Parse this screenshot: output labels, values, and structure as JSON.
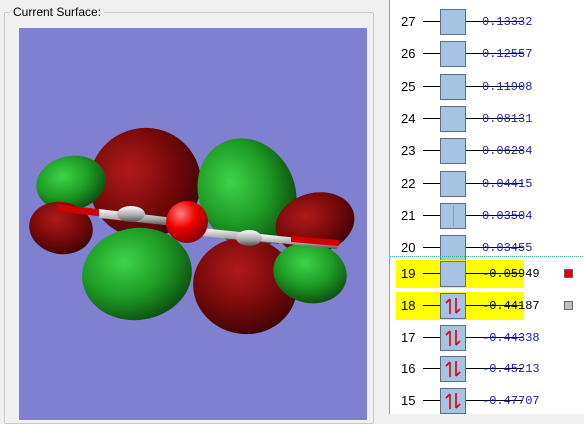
{
  "surface_group": {
    "title": "Current Surface:"
  },
  "viewport": {
    "background": "#8080d0",
    "lobe_colors": {
      "positive": "#1f8a22",
      "negative": "#7a0a0a"
    },
    "atom_colors": {
      "oxygen": "#e00000",
      "carbon": "#b0b0b0"
    }
  },
  "orbitals": [
    {
      "number": "27",
      "energy": "0.13332",
      "electrons": "none",
      "highlighted": false
    },
    {
      "number": "26",
      "energy": "0.12557",
      "electrons": "none",
      "highlighted": false
    },
    {
      "number": "25",
      "energy": "0.11908",
      "electrons": "none",
      "highlighted": false
    },
    {
      "number": "24",
      "energy": "0.08131",
      "electrons": "none",
      "highlighted": false
    },
    {
      "number": "23",
      "energy": "0.06284",
      "electrons": "none",
      "highlighted": false
    },
    {
      "number": "22",
      "energy": "0.04415",
      "electrons": "none",
      "highlighted": false
    },
    {
      "number": "21",
      "energy": "0.03504",
      "electrons": "none",
      "highlighted": false,
      "degenerate": true
    },
    {
      "number": "20",
      "energy": "0.03455",
      "electrons": "none",
      "highlighted": false
    },
    {
      "number": "19",
      "energy": "-0.05949",
      "electrons": "none",
      "highlighted": true,
      "marker": "#e00000"
    },
    {
      "number": "18",
      "energy": "-0.44187",
      "electrons": "pair",
      "highlighted": true,
      "marker": "#c0c0c0"
    },
    {
      "number": "17",
      "energy": "-0.44338",
      "electrons": "pair",
      "highlighted": false
    },
    {
      "number": "16",
      "energy": "-0.45213",
      "electrons": "pair",
      "highlighted": false
    },
    {
      "number": "15",
      "energy": "-0.47707",
      "electrons": "pair",
      "highlighted": false
    }
  ],
  "colors": {
    "highlight": "#ffff00",
    "energy_text": "#1b22b8",
    "orbital_box": "#a6c3e3",
    "electron_arrow": "#e00000"
  }
}
